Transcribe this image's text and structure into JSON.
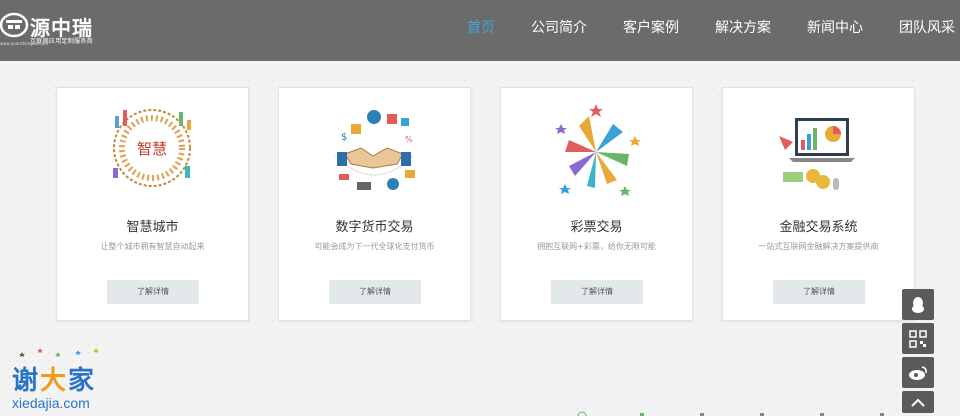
{
  "header": {
    "logo": {
      "name": "源中瑞",
      "tagline": "互联网应用定制服务商",
      "url": "www.yuanzhongrui.com"
    },
    "nav": [
      {
        "label": "首页",
        "active": true
      },
      {
        "label": "公司简介",
        "active": false
      },
      {
        "label": "客户案例",
        "active": false
      },
      {
        "label": "解决方案",
        "active": false
      },
      {
        "label": "新闻中心",
        "active": false
      },
      {
        "label": "团队风采",
        "active": false
      }
    ]
  },
  "cards": [
    {
      "title": "智慧城市",
      "desc": "让整个城市拥有智慧自动起来",
      "button": "了解详情",
      "icon": "smart-city-illustration",
      "badge": "智慧"
    },
    {
      "title": "数字货币交易",
      "desc": "可能会成为下一代全球化支付货币",
      "button": "了解详情",
      "icon": "handshake-currency-illustration"
    },
    {
      "title": "彩票交易",
      "desc": "拥抱互联网+彩票，给你无限可能",
      "button": "了解详情",
      "icon": "lottery-stars-illustration"
    },
    {
      "title": "金融交易系统",
      "desc": "一站式互联网金融解决方案提供商",
      "button": "了解详情",
      "icon": "finance-laptop-illustration"
    }
  ],
  "side_tools": [
    {
      "icon": "qq-icon"
    },
    {
      "icon": "qrcode-icon"
    },
    {
      "icon": "weibo-icon"
    },
    {
      "icon": "back-to-top-icon"
    }
  ],
  "watermark": {
    "text_1": "谢",
    "text_2": "大",
    "text_3": "家",
    "url": "xiedajia.com"
  },
  "colors": {
    "header_bg": "#6b6b6b",
    "nav_active": "#3ea6d9",
    "button_bg": "#e3e8ea",
    "tool_bg": "#5b5b5b"
  }
}
